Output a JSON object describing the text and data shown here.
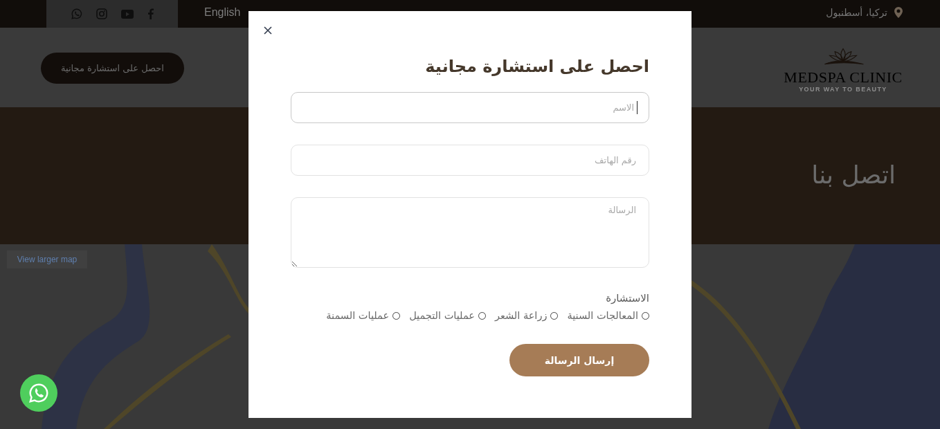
{
  "top_bar": {
    "social_links": [
      {
        "kind": "whatsapp"
      },
      {
        "kind": "instagram"
      },
      {
        "kind": "youtube"
      },
      {
        "kind": "facebook"
      }
    ],
    "language_link": "English",
    "location": "تركيا، أسطنبول"
  },
  "header": {
    "logo": {
      "name": "MEDSPA CLINIC",
      "tagline": "YOUR WAY TO BEAUTY"
    },
    "cta_button": "احصل على استشارة مجانية"
  },
  "hero": {
    "title": "اتصل بنا"
  },
  "map": {
    "larger_map_link": "View larger map"
  },
  "modal": {
    "title": "احصل على استشارة مجانية",
    "fields": [
      {
        "kind": "input",
        "placeholder": "الاسم",
        "focused": true
      },
      {
        "kind": "input",
        "placeholder": "رقم الهاتف",
        "focused": false
      },
      {
        "kind": "textarea",
        "placeholder": "الرسالة",
        "focused": false
      }
    ],
    "consultation": {
      "label": "الاستشارة",
      "options": [
        {
          "label": "المعالجات السنية",
          "selected": false
        },
        {
          "label": "زراعة الشعر",
          "selected": false
        },
        {
          "label": "عمليات التجميل",
          "selected": false
        },
        {
          "label": "عمليات السمنة",
          "selected": false
        }
      ]
    },
    "submit_button": "إرسال الرسالة"
  }
}
